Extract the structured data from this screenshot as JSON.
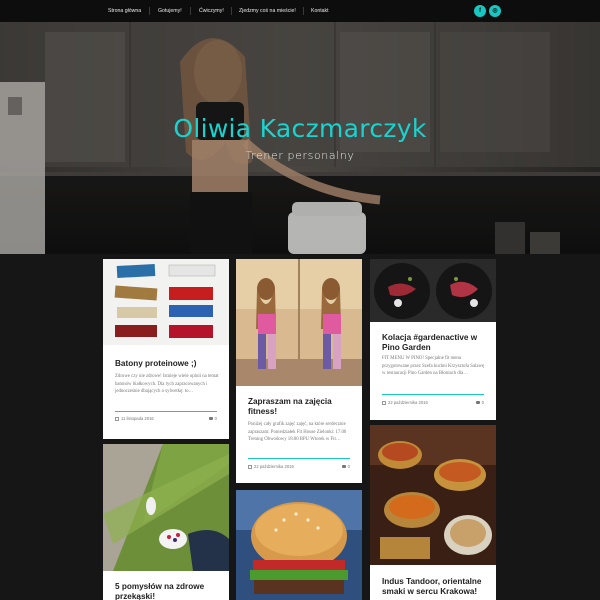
{
  "nav": {
    "items": [
      "Strona główna",
      "Gotujemy!",
      "Ćwiczymy!",
      "Zjedzmy coś na mieście!",
      "Kontakt"
    ],
    "social": [
      {
        "icon": "facebook-icon",
        "glyph": "f"
      },
      {
        "icon": "instagram-icon",
        "glyph": "◎"
      }
    ]
  },
  "hero": {
    "title": "Oliwia Kaczmarczyk",
    "subtitle": "Trener personalny"
  },
  "colors": {
    "accent": "#19c7c2",
    "background": "#161616",
    "card": "#ffffff"
  },
  "posts": [
    {
      "title": "Batony proteinowe ;)",
      "excerpt": "Zdrowe czy nie zdrowe! Istnieje wiele opinii na temat batonów białkowych. Dla tych zapracowanych i jednocześnie dbających o sylwetkę: to…",
      "date": "11 listopada 2016",
      "comments": "0"
    },
    {
      "title": "Zapraszam na zajęcia fitness!",
      "excerpt": "Poniżej cały grafik zajęć zajęć, na które serdecznie zapraszam: Poniedziałek Fit House Zielonki: 17.00 Trening Obwodowy 18.00 BPU Wtorek w Fit…",
      "date": "22 października 2016",
      "comments": "0"
    },
    {
      "title": "Kolacja #gardenactive w Pino Garden",
      "excerpt": "FIT MENU W PINO! Specjalne fit menu przygotowane przez Szefa kuchni Krzysztofa Salawę w restauracji Pino Garden na Błoniach dla…",
      "date": "22 października 2016",
      "comments": "0"
    },
    {
      "title": "5 pomysłów na zdrowe przekąski!",
      "excerpt": "",
      "date": "",
      "comments": ""
    },
    {
      "title": "",
      "excerpt": "",
      "date": "",
      "comments": ""
    },
    {
      "title": "Indus Tandoor, orientalne smaki w sercu Krakowa!",
      "excerpt": "",
      "date": "",
      "comments": ""
    }
  ]
}
